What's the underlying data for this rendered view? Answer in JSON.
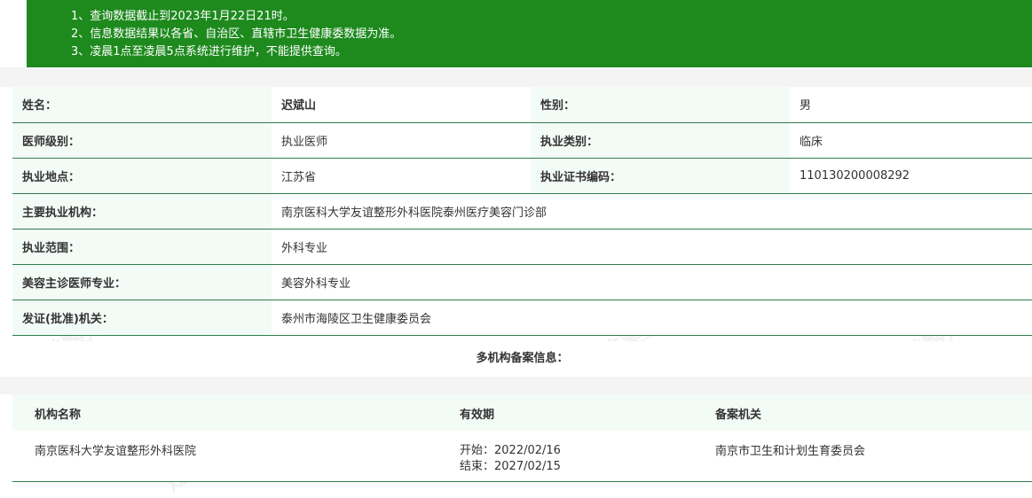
{
  "notice": {
    "lines": [
      "1、查询数据截止到2023年1月22日21时。",
      "2、信息数据结果以各省、自治区、直辖市卫生健康委数据为准。",
      "3、凌晨1点至凌晨5点系统进行维护，不能提供查询。"
    ]
  },
  "info": {
    "name_label": "姓名：",
    "name_value": "迟斌山",
    "gender_label": "性别：",
    "gender_value": "男",
    "level_label": "医师级别：",
    "level_value": "执业医师",
    "category_label": "执业类别：",
    "category_value": "临床",
    "location_label": "执业地点：",
    "location_value": "江苏省",
    "cert_label": "执业证书编码：",
    "cert_value": "110130200008292",
    "org_label": "主要执业机构：",
    "org_value": "南京医科大学友谊整形外科医院泰州医疗美容门诊部",
    "scope_label": "执业范围：",
    "scope_value": "外科专业",
    "beauty_label": "美容主诊医师专业：",
    "beauty_value": "美容外科专业",
    "issuer_label": "发证(批准)机关：",
    "issuer_value": "泰州市海陵区卫生健康委员会"
  },
  "multi": {
    "title": "多机构备案信息：",
    "headers": [
      "机构名称",
      "有效期",
      "备案机关"
    ],
    "row": {
      "org": "南京医科大学友谊整形外科医院",
      "start": "开始：2022/02/16",
      "end": "结束：2027/02/15",
      "authority": "南京市卫生和计划生育委员会"
    }
  },
  "watermark": "炫美整形"
}
